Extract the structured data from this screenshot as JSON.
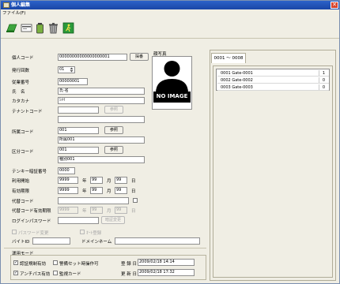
{
  "window": {
    "title": "個人編集",
    "close_glyph": "✕"
  },
  "menu": {
    "file_label": "ファイル(F)"
  },
  "toolbar": {
    "icons": [
      "save-green-icon",
      "card-icon",
      "battery-icon",
      "trash-icon",
      "exit-door-icon"
    ]
  },
  "form": {
    "personal_code": {
      "label": "個人コード",
      "value": "00000000000000000001",
      "button": "採番"
    },
    "issue_count": {
      "label": "発行回数",
      "value": "01"
    },
    "employee_no": {
      "label": "従業番号",
      "value": "00000001"
    },
    "name": {
      "label": "氏　名",
      "value": "氏-名"
    },
    "kana": {
      "label": "カタカナ",
      "value": "ｼﾒｲ"
    },
    "tenant_code": {
      "label": "テナントコード",
      "value": "",
      "button": "参照",
      "sub_value": ""
    },
    "dept_code": {
      "label": "所属コード",
      "value": "001",
      "button": "参照",
      "sub_value": "所属001"
    },
    "class_code": {
      "label": "区分コード",
      "value": "001",
      "button": "参照",
      "sub_value": "種別001"
    },
    "tenkey_pin": {
      "label": "テンキー暗証番号",
      "value": "0000"
    },
    "valid_start": {
      "label": "利用開始",
      "year": "9999",
      "month": "99",
      "day": "99",
      "y": "年",
      "m": "月",
      "d": "日"
    },
    "valid_end": {
      "label": "有効期限",
      "year": "9999",
      "month": "99",
      "day": "99",
      "y": "年",
      "m": "月",
      "d": "日"
    },
    "proxy_code": {
      "label": "代替コード",
      "value": ""
    },
    "proxy_expiry": {
      "label": "代替コード有効期限",
      "year": "9999",
      "month": "99",
      "day": "99",
      "y": "年",
      "m": "月",
      "d": "日"
    },
    "login_password": {
      "label": "ログインパスワード",
      "value": "",
      "button": "暗証変更"
    },
    "password_check_label": "パスワード変更",
    "auto_check_label": "ｵｰﾄ登録",
    "byte_label": "バイトID",
    "domain_label": "ドメインネーム",
    "photo": {
      "label": "顔写真",
      "placeholder": "NO IMAGE"
    }
  },
  "mode": {
    "group_label": "運用モード",
    "passback_label": "認証規制有効",
    "guard_label": "警備セット時操作可",
    "antipass_label": "アンチパス有効",
    "monitor_label": "監視カード",
    "registered": {
      "label": "登 録 日",
      "value": "2009/02/18 14:14"
    },
    "updated": {
      "label": "更 新 日",
      "value": "2009/02/18 17:32"
    }
  },
  "right": {
    "tab_label": "0001 ～ 0008",
    "list": [
      {
        "label": "0001 Gate-0001",
        "value": "1"
      },
      {
        "label": "0002 Gate-0002",
        "value": "0"
      },
      {
        "label": "0003 Gate-0003",
        "value": "0"
      }
    ]
  }
}
